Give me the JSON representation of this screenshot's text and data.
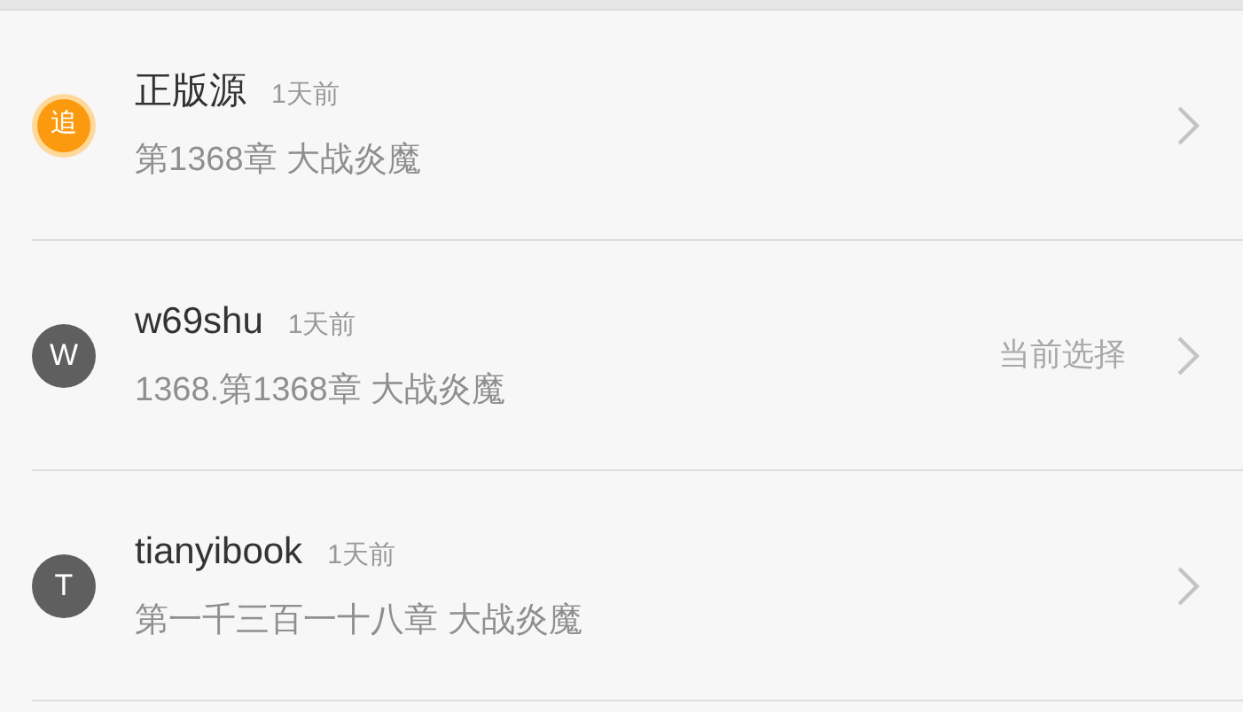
{
  "current_label": "当前选择",
  "sources": [
    {
      "avatar": "追",
      "kind": "featured",
      "name": "正版源",
      "time": "1天前",
      "chapter": "第1368章 大战炎魔",
      "selected": false
    },
    {
      "avatar": "W",
      "kind": "letter",
      "name": "w69shu",
      "time": "1天前",
      "chapter": "1368.第1368章 大战炎魔",
      "selected": true
    },
    {
      "avatar": "T",
      "kind": "letter",
      "name": "tianyibook",
      "time": "1天前",
      "chapter": "第一千三百一十八章 大战炎魔",
      "selected": false
    }
  ]
}
